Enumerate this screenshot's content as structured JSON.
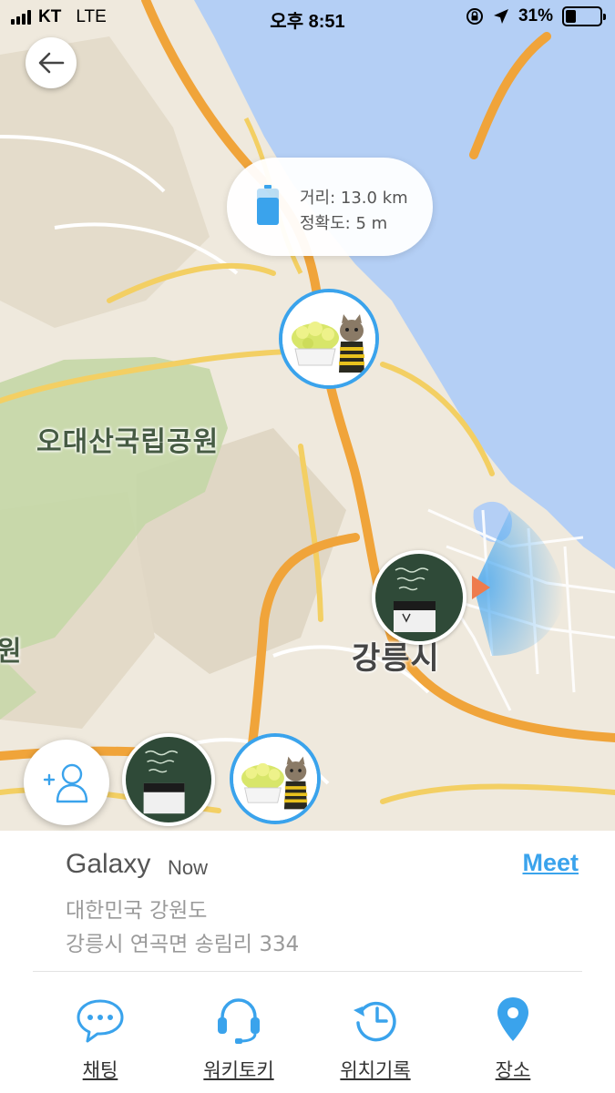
{
  "status_bar": {
    "carrier": "KT",
    "network": "LTE",
    "time": "오후 8:51",
    "battery": "31%",
    "battery_level": 0.31
  },
  "map": {
    "labels": {
      "park": "오대산국립공원",
      "city": "강릉시",
      "edge": "원"
    },
    "colors": {
      "sea": "#b4cff5",
      "land": "#efe9dd",
      "forest": "#c5d7a8",
      "road": "#f0a43a",
      "accent": "#3aa3ec"
    }
  },
  "bubble": {
    "distance": "거리: 13.0 km",
    "accuracy": "정확도: 5 m",
    "icon": "battery-icon"
  },
  "avatars": {
    "cat": "cat-photo",
    "chalkboard": "chalkboard-photo"
  },
  "panel": {
    "name": "Galaxy",
    "when": "Now",
    "meet": "Meet",
    "address_line1": "대한민국 강원도",
    "address_line2": "강릉시 연곡면 송림리 334"
  },
  "tabs": [
    {
      "label": "채팅",
      "icon": "chat-icon"
    },
    {
      "label": "워키토키",
      "icon": "headset-icon"
    },
    {
      "label": "위치기록",
      "icon": "history-icon"
    },
    {
      "label": "장소",
      "icon": "pin-icon"
    }
  ]
}
